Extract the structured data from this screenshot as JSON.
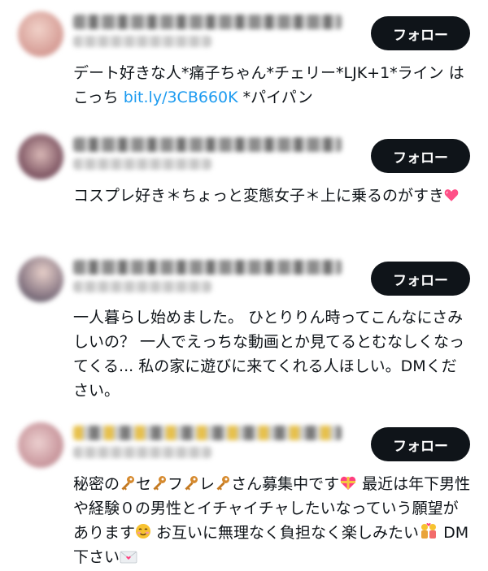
{
  "follow_label": "フォロー",
  "users": [
    {
      "bio": {
        "part1": "デート好きな人*痛子ちゃん*チェリー*LJK+1*ライン はこっち ",
        "link": "bit.ly/3CB660K",
        "part2": " *パイパン"
      }
    },
    {
      "bio": {
        "part1": "コスプレ好き＊ちょっと変態女子＊上に乗るのがすき",
        "emoji": "pink-heart-icon"
      }
    },
    {
      "bio": {
        "text": "一人暮らし始めました。 ひとりりん時ってこんなにさみしいの？ 一人でえっちな動画とか見てるとむなしくなってくる... 私の家に遊びに来てくれる人ほしい。DMください。"
      }
    },
    {
      "bio": {
        "t1": "秘密の",
        "t2": "セ",
        "t3": "フ",
        "t4": "レ",
        "t5": "さん募集中です",
        "t6": " 最近は年下男性や経験０の男性とイチャイチャしたいなっていう願望があります",
        "t7": " お互いに無理なく負担なく楽しみたい",
        "t8": " DM下さい"
      }
    }
  ],
  "colors": {
    "button_bg": "#0f1419",
    "link": "#1d9bf0",
    "text": "#0f1419"
  }
}
